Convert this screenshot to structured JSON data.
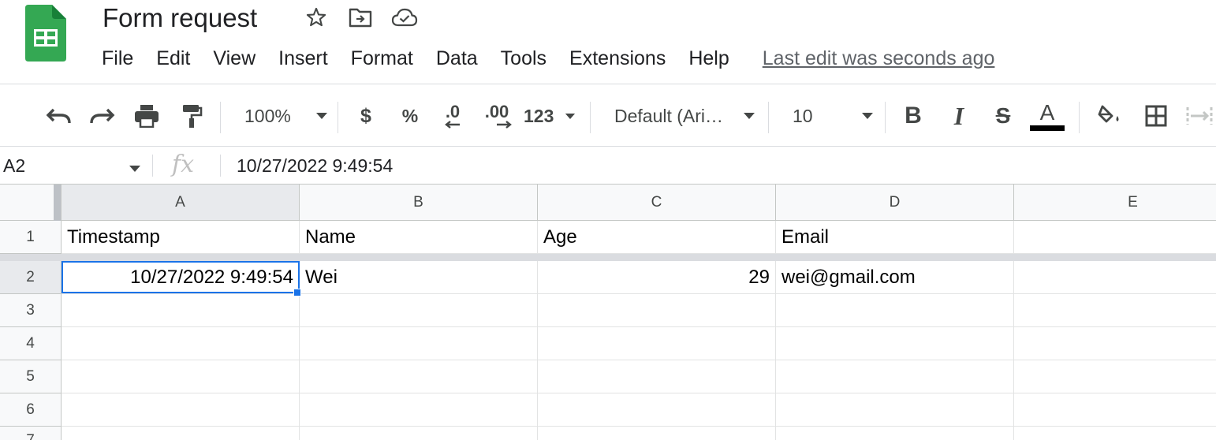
{
  "document": {
    "title": "Form request",
    "last_edit": "Last edit was seconds ago"
  },
  "title_icons": [
    "star-icon",
    "move-to-folder-icon",
    "cloud-saved-icon"
  ],
  "menu": [
    "File",
    "Edit",
    "View",
    "Insert",
    "Format",
    "Data",
    "Tools",
    "Extensions",
    "Help"
  ],
  "toolbar": {
    "zoom": "100%",
    "currency": "$",
    "percent": "%",
    "decrease_decimal": ".0",
    "increase_decimal": ".00",
    "more_formats": "123",
    "font": "Default (Ari…",
    "font_size": "10",
    "bold": "B",
    "italic": "I",
    "strikethrough": "S",
    "text_color_letter": "A",
    "text_color": "#000000"
  },
  "formula_bar": {
    "name_box": "A2",
    "fx": "fx",
    "value": "10/27/2022 9:49:54"
  },
  "sheet": {
    "columns": [
      "A",
      "B",
      "C",
      "D",
      "E"
    ],
    "rows": [
      "1",
      "2",
      "3",
      "4",
      "5",
      "6",
      "7"
    ],
    "header_row": [
      "Timestamp",
      "Name",
      "Age",
      "Email",
      ""
    ],
    "data_rows": [
      [
        "10/27/2022 9:49:54",
        "Wei",
        "29",
        "wei@gmail.com",
        ""
      ]
    ],
    "selected_cell": "A2"
  },
  "colors": {
    "selection": "#1a73e8",
    "logo_green": "#34a853",
    "header_bg": "#f8f9fa"
  }
}
